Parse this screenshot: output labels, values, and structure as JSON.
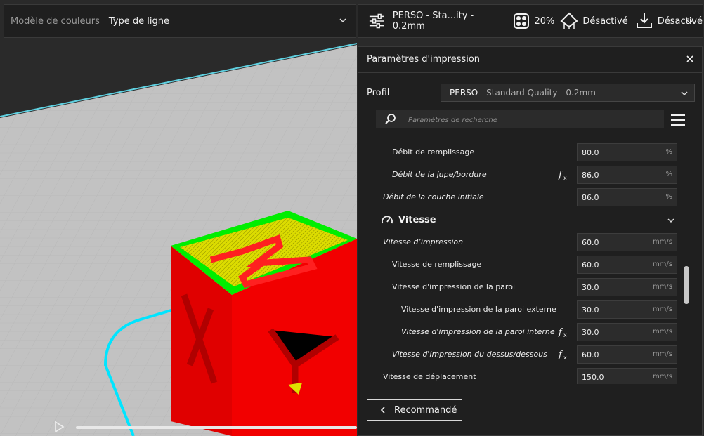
{
  "topbar": {
    "color_scheme_label": "Modèle de couleurs",
    "color_scheme_value": "Type de ligne",
    "profile_short": "PERSO - Sta...ity - 0.2mm",
    "infill_value": "20%",
    "support_value": "Désactivé",
    "adhesion_value": "Désactivé"
  },
  "panel": {
    "title": "Paramètres d'impression",
    "profile_label": "Profil",
    "profile_bold": "PERSO",
    "profile_rest": " - Standard Quality - 0.2mm",
    "search_placeholder": "Paramètres de recherche",
    "section_title": "Vitesse",
    "recommended_label": "Recommandé"
  },
  "settings_before": [
    {
      "name": "Débit de remplissage",
      "value": "80.0",
      "unit": "%",
      "indent": 1,
      "italic": false,
      "fx": false
    },
    {
      "name": "Débit de la jupe/bordure",
      "value": "86.0",
      "unit": "%",
      "indent": 1,
      "italic": true,
      "fx": true
    },
    {
      "name": "Débit de la couche initiale",
      "value": "86.0",
      "unit": "%",
      "indent": 0,
      "italic": true,
      "fx": false
    }
  ],
  "settings_after": [
    {
      "name": "Vitesse d’impression",
      "value": "60.0",
      "unit": "mm/s",
      "indent": 0,
      "italic": true,
      "fx": false
    },
    {
      "name": "Vitesse de remplissage",
      "value": "60.0",
      "unit": "mm/s",
      "indent": 1,
      "italic": false,
      "fx": false
    },
    {
      "name": "Vitesse d'impression de la paroi",
      "value": "30.0",
      "unit": "mm/s",
      "indent": 1,
      "italic": false,
      "fx": false
    },
    {
      "name": "Vitesse d'impression de la paroi externe",
      "value": "30.0",
      "unit": "mm/s",
      "indent": 2,
      "italic": false,
      "fx": false
    },
    {
      "name": "Vitesse d'impression de la paroi interne",
      "value": "30.0",
      "unit": "mm/s",
      "indent": 2,
      "italic": true,
      "fx": true
    },
    {
      "name": "Vitesse d'impression du dessus/dessous",
      "value": "60.0",
      "unit": "mm/s",
      "indent": 1,
      "italic": true,
      "fx": true
    },
    {
      "name": "Vitesse de déplacement",
      "value": "150.0",
      "unit": "mm/s",
      "indent": 0,
      "italic": false,
      "fx": false
    }
  ],
  "colors": {
    "cube_red": "#ff0000",
    "infill_yellow": "#f0f000",
    "skin_green": "#00ff00",
    "travel_cyan": "#00e5ff"
  }
}
